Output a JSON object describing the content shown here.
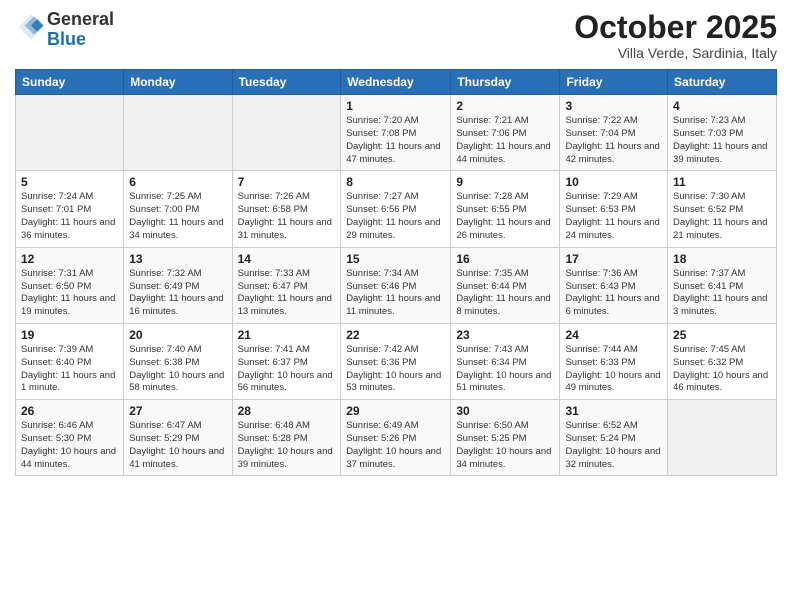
{
  "logo": {
    "general": "General",
    "blue": "Blue"
  },
  "header": {
    "month": "October 2025",
    "location": "Villa Verde, Sardinia, Italy"
  },
  "days_of_week": [
    "Sunday",
    "Monday",
    "Tuesday",
    "Wednesday",
    "Thursday",
    "Friday",
    "Saturday"
  ],
  "weeks": [
    [
      {
        "day": "",
        "info": ""
      },
      {
        "day": "",
        "info": ""
      },
      {
        "day": "",
        "info": ""
      },
      {
        "day": "1",
        "info": "Sunrise: 7:20 AM\nSunset: 7:08 PM\nDaylight: 11 hours and 47 minutes."
      },
      {
        "day": "2",
        "info": "Sunrise: 7:21 AM\nSunset: 7:06 PM\nDaylight: 11 hours and 44 minutes."
      },
      {
        "day": "3",
        "info": "Sunrise: 7:22 AM\nSunset: 7:04 PM\nDaylight: 11 hours and 42 minutes."
      },
      {
        "day": "4",
        "info": "Sunrise: 7:23 AM\nSunset: 7:03 PM\nDaylight: 11 hours and 39 minutes."
      }
    ],
    [
      {
        "day": "5",
        "info": "Sunrise: 7:24 AM\nSunset: 7:01 PM\nDaylight: 11 hours and 36 minutes."
      },
      {
        "day": "6",
        "info": "Sunrise: 7:25 AM\nSunset: 7:00 PM\nDaylight: 11 hours and 34 minutes."
      },
      {
        "day": "7",
        "info": "Sunrise: 7:26 AM\nSunset: 6:58 PM\nDaylight: 11 hours and 31 minutes."
      },
      {
        "day": "8",
        "info": "Sunrise: 7:27 AM\nSunset: 6:56 PM\nDaylight: 11 hours and 29 minutes."
      },
      {
        "day": "9",
        "info": "Sunrise: 7:28 AM\nSunset: 6:55 PM\nDaylight: 11 hours and 26 minutes."
      },
      {
        "day": "10",
        "info": "Sunrise: 7:29 AM\nSunset: 6:53 PM\nDaylight: 11 hours and 24 minutes."
      },
      {
        "day": "11",
        "info": "Sunrise: 7:30 AM\nSunset: 6:52 PM\nDaylight: 11 hours and 21 minutes."
      }
    ],
    [
      {
        "day": "12",
        "info": "Sunrise: 7:31 AM\nSunset: 6:50 PM\nDaylight: 11 hours and 19 minutes."
      },
      {
        "day": "13",
        "info": "Sunrise: 7:32 AM\nSunset: 6:49 PM\nDaylight: 11 hours and 16 minutes."
      },
      {
        "day": "14",
        "info": "Sunrise: 7:33 AM\nSunset: 6:47 PM\nDaylight: 11 hours and 13 minutes."
      },
      {
        "day": "15",
        "info": "Sunrise: 7:34 AM\nSunset: 6:46 PM\nDaylight: 11 hours and 11 minutes."
      },
      {
        "day": "16",
        "info": "Sunrise: 7:35 AM\nSunset: 6:44 PM\nDaylight: 11 hours and 8 minutes."
      },
      {
        "day": "17",
        "info": "Sunrise: 7:36 AM\nSunset: 6:43 PM\nDaylight: 11 hours and 6 minutes."
      },
      {
        "day": "18",
        "info": "Sunrise: 7:37 AM\nSunset: 6:41 PM\nDaylight: 11 hours and 3 minutes."
      }
    ],
    [
      {
        "day": "19",
        "info": "Sunrise: 7:39 AM\nSunset: 6:40 PM\nDaylight: 11 hours and 1 minute."
      },
      {
        "day": "20",
        "info": "Sunrise: 7:40 AM\nSunset: 6:38 PM\nDaylight: 10 hours and 58 minutes."
      },
      {
        "day": "21",
        "info": "Sunrise: 7:41 AM\nSunset: 6:37 PM\nDaylight: 10 hours and 56 minutes."
      },
      {
        "day": "22",
        "info": "Sunrise: 7:42 AM\nSunset: 6:36 PM\nDaylight: 10 hours and 53 minutes."
      },
      {
        "day": "23",
        "info": "Sunrise: 7:43 AM\nSunset: 6:34 PM\nDaylight: 10 hours and 51 minutes."
      },
      {
        "day": "24",
        "info": "Sunrise: 7:44 AM\nSunset: 6:33 PM\nDaylight: 10 hours and 49 minutes."
      },
      {
        "day": "25",
        "info": "Sunrise: 7:45 AM\nSunset: 6:32 PM\nDaylight: 10 hours and 46 minutes."
      }
    ],
    [
      {
        "day": "26",
        "info": "Sunrise: 6:46 AM\nSunset: 5:30 PM\nDaylight: 10 hours and 44 minutes."
      },
      {
        "day": "27",
        "info": "Sunrise: 6:47 AM\nSunset: 5:29 PM\nDaylight: 10 hours and 41 minutes."
      },
      {
        "day": "28",
        "info": "Sunrise: 6:48 AM\nSunset: 5:28 PM\nDaylight: 10 hours and 39 minutes."
      },
      {
        "day": "29",
        "info": "Sunrise: 6:49 AM\nSunset: 5:26 PM\nDaylight: 10 hours and 37 minutes."
      },
      {
        "day": "30",
        "info": "Sunrise: 6:50 AM\nSunset: 5:25 PM\nDaylight: 10 hours and 34 minutes."
      },
      {
        "day": "31",
        "info": "Sunrise: 6:52 AM\nSunset: 5:24 PM\nDaylight: 10 hours and 32 minutes."
      },
      {
        "day": "",
        "info": ""
      }
    ]
  ]
}
